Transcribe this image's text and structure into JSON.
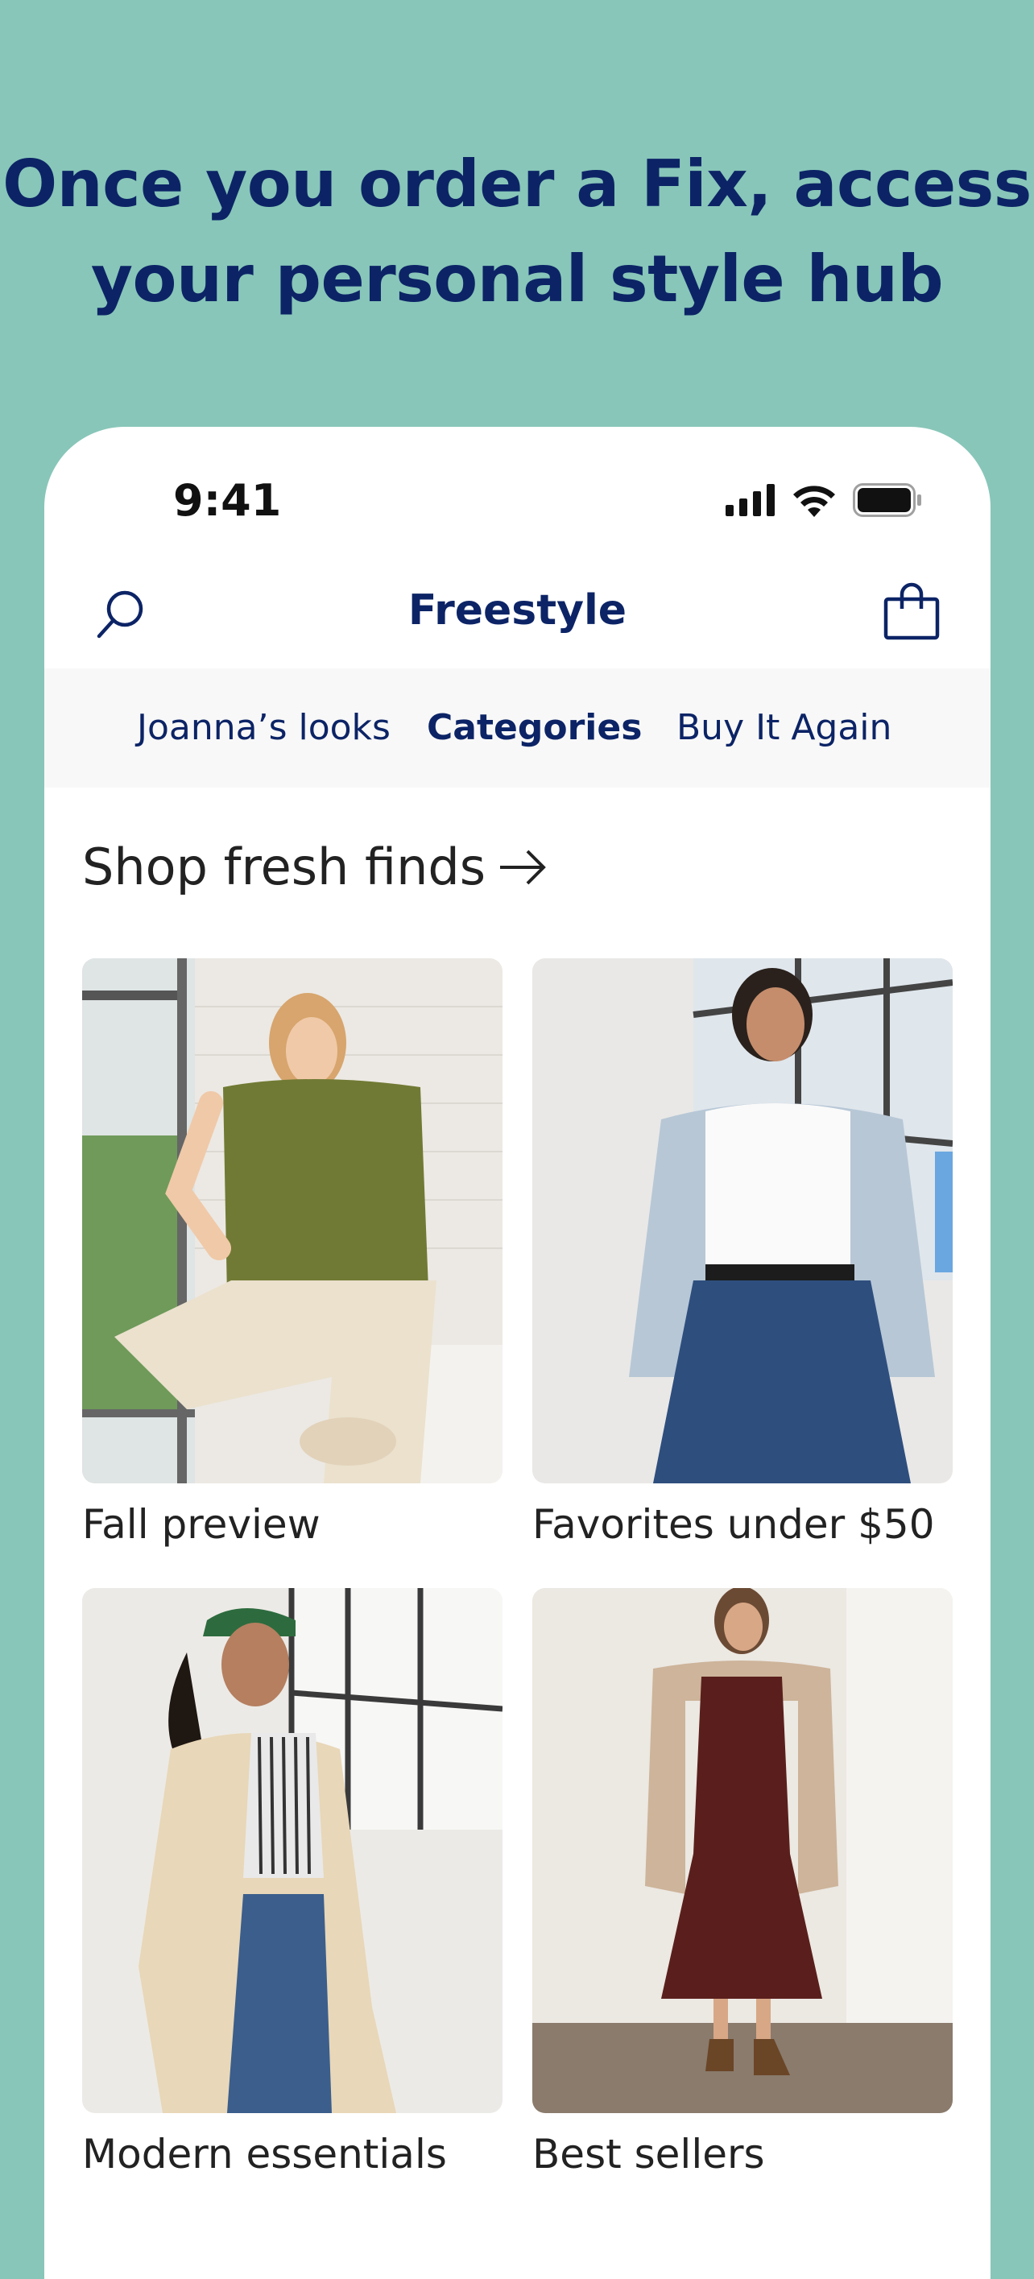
{
  "headline": {
    "line1": "Once you order a Fix, access",
    "line2": "your personal style hub"
  },
  "status_bar": {
    "time": "9:41",
    "icons": [
      "cellular-signal-icon",
      "wifi-icon",
      "battery-icon"
    ]
  },
  "navbar": {
    "title": "Freestyle",
    "left_icon": "search-icon",
    "right_icon": "shopping-bag-icon"
  },
  "tabs": [
    {
      "label": "Joanna’s looks",
      "active": false
    },
    {
      "label": "Categories",
      "active": true
    },
    {
      "label": "Buy It Again",
      "active": false
    }
  ],
  "section": {
    "title": "Shop fresh finds",
    "arrow_icon": "arrow-right-icon"
  },
  "cards": [
    {
      "label": "Fall preview"
    },
    {
      "label": "Favorites under $50"
    },
    {
      "label": "Modern essentials"
    },
    {
      "label": "Best sellers"
    }
  ],
  "colors": {
    "background": "#88c6b9",
    "brand_navy": "#0c2466",
    "tab_bar_bg": "#f8f8f8"
  }
}
